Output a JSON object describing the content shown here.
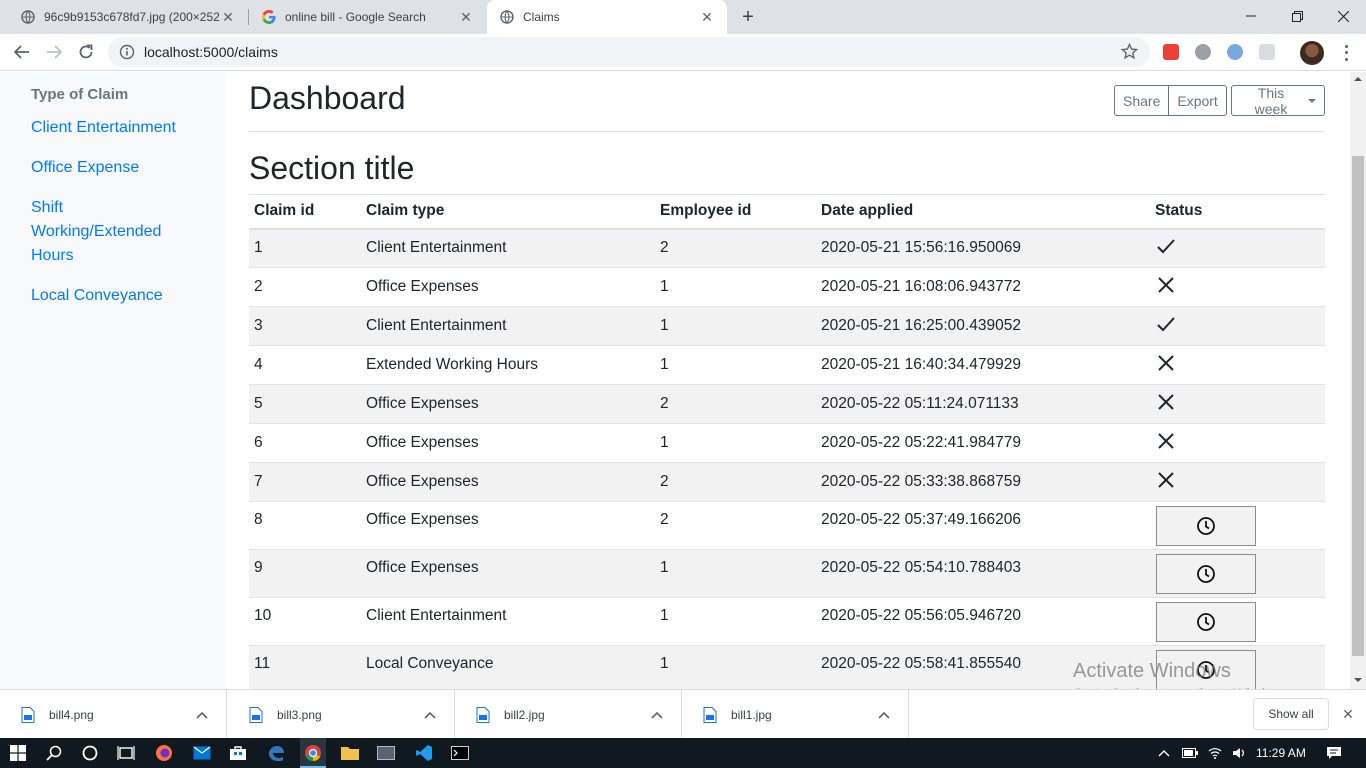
{
  "browser": {
    "tabs": [
      {
        "title": "96c9b9153c678fd7.jpg (200×252)",
        "active": false
      },
      {
        "title": "online bill - Google Search",
        "active": false
      },
      {
        "title": "Claims",
        "active": true
      }
    ],
    "url": "localhost:5000/claims"
  },
  "sidebar": {
    "heading": "Type of Claim",
    "links": [
      "Client Entertainment",
      "Office Expense",
      "Shift Working/Extended Hours",
      "Local Conveyance"
    ]
  },
  "main": {
    "title": "Dashboard",
    "share_label": "Share",
    "export_label": "Export",
    "range_label": "This week",
    "section_title": "Section title"
  },
  "table": {
    "headers": [
      "Claim id",
      "Claim type",
      "Employee id",
      "Date applied",
      "Status"
    ],
    "rows": [
      {
        "id": "1",
        "type": "Client Entertainment",
        "emp": "2",
        "date": "2020-05-21 15:56:16.950069",
        "status": "approved"
      },
      {
        "id": "2",
        "type": "Office Expenses",
        "emp": "1",
        "date": "2020-05-21 16:08:06.943772",
        "status": "rejected"
      },
      {
        "id": "3",
        "type": "Client Entertainment",
        "emp": "1",
        "date": "2020-05-21 16:25:00.439052",
        "status": "approved"
      },
      {
        "id": "4",
        "type": "Extended Working Hours",
        "emp": "1",
        "date": "2020-05-21 16:40:34.479929",
        "status": "rejected"
      },
      {
        "id": "5",
        "type": "Office Expenses",
        "emp": "2",
        "date": "2020-05-22 05:11:24.071133",
        "status": "rejected"
      },
      {
        "id": "6",
        "type": "Office Expenses",
        "emp": "1",
        "date": "2020-05-22 05:22:41.984779",
        "status": "rejected"
      },
      {
        "id": "7",
        "type": "Office Expenses",
        "emp": "2",
        "date": "2020-05-22 05:33:38.868759",
        "status": "rejected"
      },
      {
        "id": "8",
        "type": "Office Expenses",
        "emp": "2",
        "date": "2020-05-22 05:37:49.166206",
        "status": "pending"
      },
      {
        "id": "9",
        "type": "Office Expenses",
        "emp": "1",
        "date": "2020-05-22 05:54:10.788403",
        "status": "pending"
      },
      {
        "id": "10",
        "type": "Client Entertainment",
        "emp": "1",
        "date": "2020-05-22 05:56:05.946720",
        "status": "pending"
      },
      {
        "id": "11",
        "type": "Local Conveyance",
        "emp": "1",
        "date": "2020-05-22 05:58:41.855540",
        "status": "pending"
      }
    ]
  },
  "watermark": {
    "line1": "Activate Windows",
    "line2": "Go to Settings to activate Windows."
  },
  "downloads": {
    "items": [
      "bill4.png",
      "bill3.png",
      "bill2.jpg",
      "bill1.jpg"
    ],
    "show_all_label": "Show all"
  },
  "taskbar": {
    "time": "11:29 AM"
  },
  "colors": {
    "link": "#007bff",
    "sidebar_bg": "#f8f9fa",
    "stripe": "#f2f2f2"
  }
}
